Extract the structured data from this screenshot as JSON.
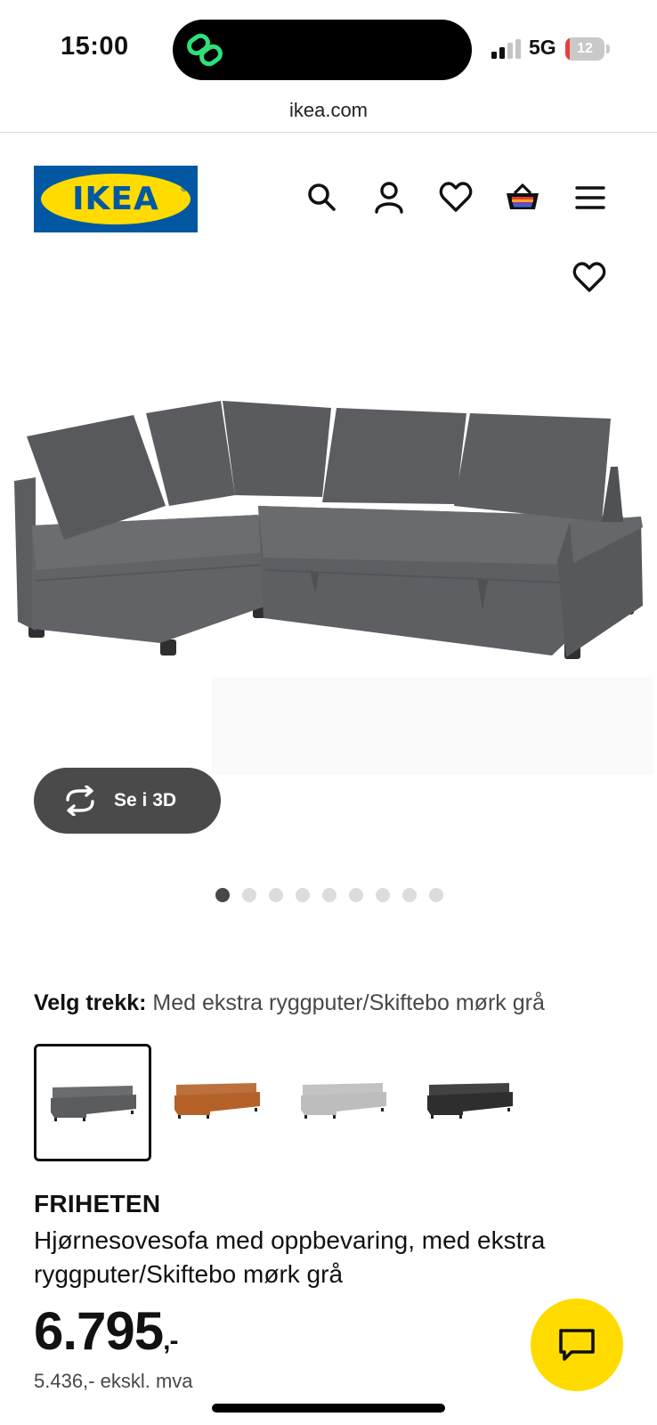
{
  "status_bar": {
    "time": "15:00",
    "network": "5G",
    "battery_level": "12",
    "battery_fraction": 0.12
  },
  "browser": {
    "url": "ikea.com"
  },
  "header": {
    "logo_text": "IKEA",
    "logo_mark": "®",
    "icons": [
      "search-icon",
      "account-icon",
      "heart-icon",
      "basket-icon",
      "menu-icon"
    ]
  },
  "gallery": {
    "view_3d_label": "Se i 3D",
    "dot_count": 9,
    "active_index": 0
  },
  "variant": {
    "label": "Velg trekk:",
    "value": "Med ekstra ryggputer/Skiftebo mørk grå",
    "swatch_colors": [
      "#5b5c5e",
      "#b56228",
      "#bdbdbd",
      "#2e2e2e"
    ],
    "selected_index": 0
  },
  "product": {
    "name": "FRIHETEN",
    "description": "Hjørnesovesofa med oppbevaring, med ekstra ryggputer/Skiftebo mørk grå",
    "price": "6.795",
    "price_suffix": ",-",
    "price_ex_vat": "5.436,- ekskl. mva"
  },
  "colors": {
    "ikea_blue": "#0058a3",
    "ikea_yellow": "#ffdb00",
    "button_dark": "#4a4a4a"
  }
}
